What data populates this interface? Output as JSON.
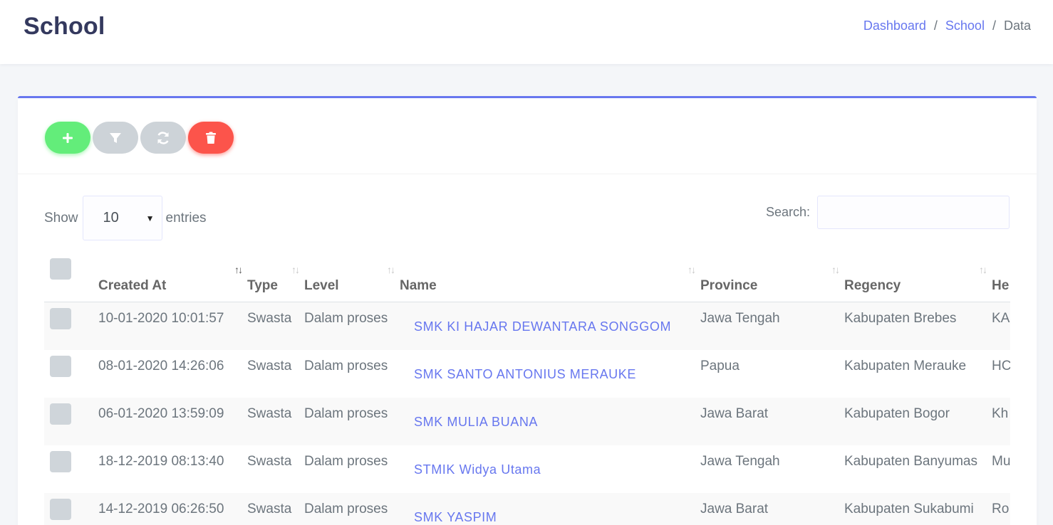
{
  "header": {
    "title": "School",
    "breadcrumb": {
      "dashboard": "Dashboard",
      "school": "School",
      "current": "Data",
      "separator": "/"
    }
  },
  "toolbar": {
    "add_icon": "plus-icon",
    "filter_icon": "filter-icon",
    "refresh_icon": "refresh-icon",
    "delete_icon": "trash-icon"
  },
  "length": {
    "show_label": "Show",
    "value": "10",
    "entries_label": "entries"
  },
  "search": {
    "label": "Search:",
    "value": "",
    "placeholder": ""
  },
  "table": {
    "columns": [
      "Created At",
      "Type",
      "Level",
      "Name",
      "Province",
      "Regency",
      "He"
    ],
    "rows": [
      {
        "created_at": "10-01-2020 10:01:57",
        "type": "Swasta",
        "level": "Dalam proses",
        "name": "SMK KI HAJAR DEWANTARA SONGGOM",
        "province": "Jawa Tengah",
        "regency": "Kabupaten Brebes",
        "head": "KA"
      },
      {
        "created_at": "08-01-2020 14:26:06",
        "type": "Swasta",
        "level": "Dalam proses",
        "name": "SMK SANTO ANTONIUS MERAUKE",
        "province": "Papua",
        "regency": "Kabupaten Merauke",
        "head": "HC"
      },
      {
        "created_at": "06-01-2020 13:59:09",
        "type": "Swasta",
        "level": "Dalam proses",
        "name": "SMK MULIA BUANA",
        "province": "Jawa Barat",
        "regency": "Kabupaten Bogor",
        "head": "Kh"
      },
      {
        "created_at": "18-12-2019 08:13:40",
        "type": "Swasta",
        "level": "Dalam proses",
        "name": "STMIK Widya Utama",
        "province": "Jawa Tengah",
        "regency": "Kabupaten Banyumas",
        "head": "Mu"
      },
      {
        "created_at": "14-12-2019 06:26:50",
        "type": "Swasta",
        "level": "Dalam proses",
        "name": "SMK YASPIM",
        "province": "Jawa Barat",
        "regency": "Kabupaten Sukabumi",
        "head": "Ro"
      }
    ]
  },
  "colors": {
    "primary": "#6777ef",
    "success": "#63ed7a",
    "danger": "#fc544b",
    "secondary": "#cdd3d8",
    "title": "#34395e"
  }
}
